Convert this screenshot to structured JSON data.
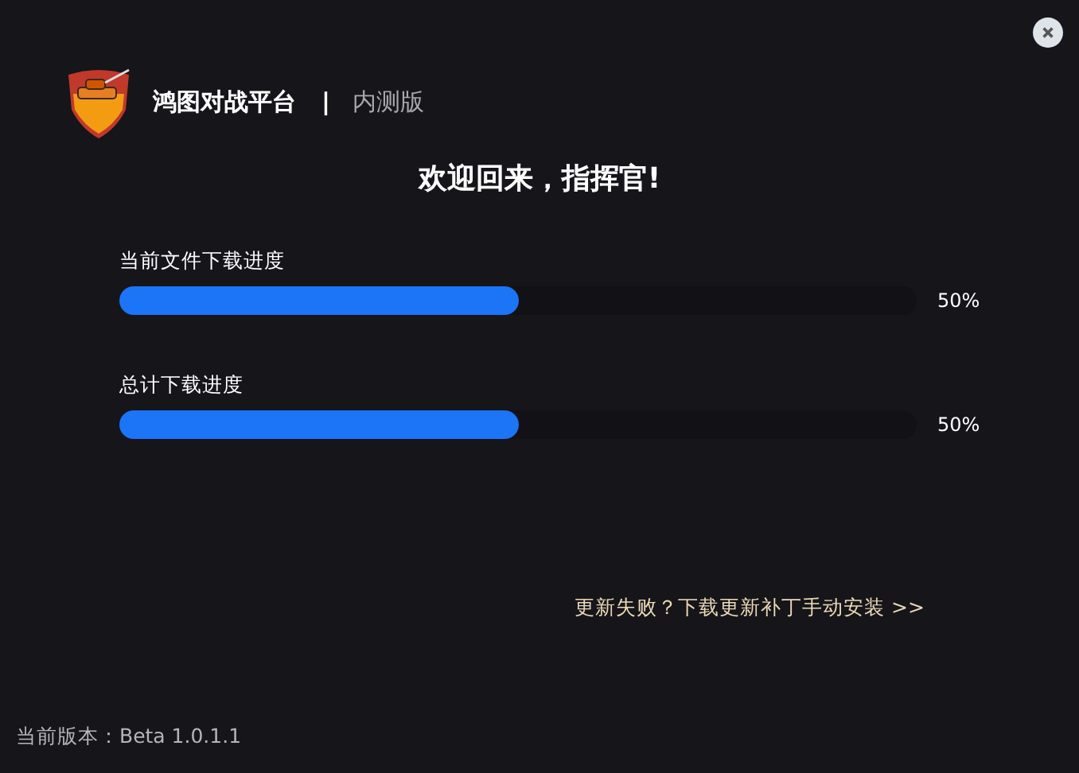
{
  "header": {
    "app_name": "鸿图对战平台",
    "separator": "|",
    "edition": "内测版"
  },
  "welcome": "欢迎回来，指挥官!",
  "progress": [
    {
      "label": "当前文件下载进度",
      "level": 0.5,
      "reading": "50%"
    },
    {
      "label": "总计下载进度",
      "level": 0.5,
      "reading": "50%"
    }
  ],
  "manual_link": "更新失败？下载更新补丁手动安装 >>",
  "version": "当前版本：Beta 1.0.1.1"
}
